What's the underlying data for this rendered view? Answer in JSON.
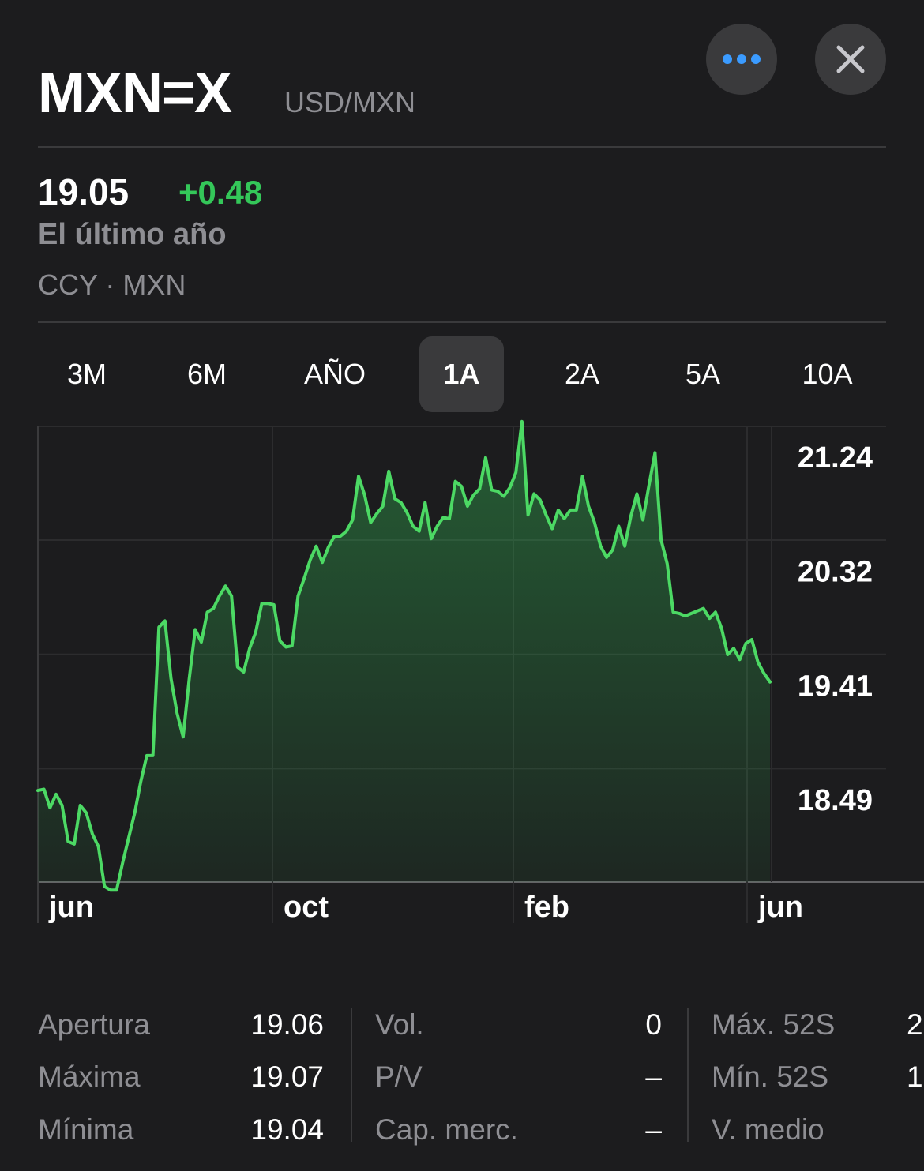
{
  "header": {
    "symbol": "MXN=X",
    "pair": "USD/MXN"
  },
  "quote": {
    "price": "19.05",
    "change": "+0.48",
    "period": "El último año",
    "exchange": "CCY · MXN"
  },
  "tabs": [
    {
      "label": "3M",
      "active": false
    },
    {
      "label": "6M",
      "active": false
    },
    {
      "label": "AÑO",
      "active": false
    },
    {
      "label": "1A",
      "active": true
    },
    {
      "label": "2A",
      "active": false
    },
    {
      "label": "5A",
      "active": false
    },
    {
      "label": "10A",
      "active": false
    }
  ],
  "colors": {
    "accent_green": "#34c759",
    "accent_blue": "#3b9bff",
    "background": "#1c1c1e"
  },
  "icons": {
    "more": "ellipsis-icon",
    "close": "close-icon"
  },
  "chart_data": {
    "type": "area",
    "y_ticks": [
      "21.24",
      "20.32",
      "19.41",
      "18.49"
    ],
    "x_ticks": [
      "jun",
      "oct",
      "feb",
      "jun"
    ],
    "ylim": [
      17.6,
      21.24
    ],
    "x": [
      0,
      1,
      2,
      3,
      4,
      5,
      6,
      7,
      8,
      9,
      10,
      11,
      12,
      13,
      14,
      15,
      16,
      17,
      18,
      19,
      20,
      21,
      22,
      23,
      24,
      25,
      26,
      27,
      28,
      29,
      30,
      31,
      32,
      33,
      34,
      35,
      36,
      37,
      38,
      39,
      40,
      41,
      42,
      43,
      44,
      45,
      46,
      47,
      48,
      49,
      50,
      51,
      52,
      53,
      54,
      55,
      56,
      57,
      58,
      59,
      60,
      61,
      62,
      63,
      64,
      65,
      66,
      67,
      68,
      69,
      70,
      71,
      72,
      73,
      74,
      75,
      76,
      77,
      78,
      79,
      80,
      81,
      82,
      83,
      84,
      85,
      86,
      87,
      88,
      89,
      90,
      91,
      92,
      93,
      94,
      95,
      96,
      97,
      98,
      99,
      100,
      101,
      102,
      103,
      104,
      105,
      106,
      107,
      108,
      109,
      110,
      111,
      112,
      113,
      114,
      115,
      116,
      117,
      118,
      119,
      120,
      121,
      122,
      123,
      124,
      125,
      126,
      127,
      128,
      129,
      130,
      131,
      132,
      133,
      134,
      135,
      136,
      137,
      138,
      139,
      140,
      141,
      142,
      143,
      144,
      145,
      146,
      147,
      148,
      149,
      150,
      151,
      152,
      153,
      154,
      155,
      156,
      157,
      158,
      159,
      160,
      161,
      162,
      163
    ],
    "values": [
      18.56,
      18.57,
      18.42,
      18.53,
      18.44,
      18.15,
      18.13,
      18.44,
      18.38,
      18.21,
      18.11,
      17.79,
      17.76,
      17.76,
      17.98,
      18.18,
      18.38,
      18.63,
      18.84,
      18.84,
      19.87,
      19.92,
      19.46,
      19.18,
      18.99,
      19.45,
      19.85,
      19.75,
      19.99,
      20.02,
      20.12,
      20.2,
      20.12,
      19.55,
      19.51,
      19.7,
      19.83,
      20.06,
      20.06,
      20.05,
      19.76,
      19.71,
      19.72,
      20.12,
      20.26,
      20.41,
      20.52,
      20.39,
      20.51,
      20.6,
      20.6,
      20.64,
      20.73,
      21.08,
      20.93,
      20.71,
      20.78,
      20.84,
      21.12,
      20.9,
      20.87,
      20.79,
      20.68,
      20.64,
      20.87,
      20.58,
      20.68,
      20.75,
      20.74,
      21.04,
      21.0,
      20.84,
      20.93,
      20.98,
      21.23,
      20.97,
      20.96,
      20.92,
      20.99,
      21.11,
      21.52,
      20.77,
      20.94,
      20.89,
      20.77,
      20.66,
      20.81,
      20.74,
      20.81,
      20.81,
      21.08,
      20.84,
      20.71,
      20.52,
      20.43,
      20.49,
      20.68,
      20.52,
      20.76,
      20.94,
      20.73,
      21.01,
      21.27,
      20.57,
      20.38,
      19.99,
      19.98,
      19.96,
      19.98,
      20.0,
      20.02,
      19.94,
      19.99,
      19.86,
      19.65,
      19.7,
      19.61,
      19.74,
      19.77,
      19.59,
      19.5,
      19.43
    ]
  },
  "stats": [
    [
      {
        "label": "Apertura",
        "value": "19.06"
      },
      {
        "label": "Máxima",
        "value": "19.07"
      },
      {
        "label": "Mínima",
        "value": "19.04"
      }
    ],
    [
      {
        "label": "Vol.",
        "value": "0"
      },
      {
        "label": "P/V",
        "value": "–"
      },
      {
        "label": "Cap. merc.",
        "value": "–"
      }
    ],
    [
      {
        "label": "Máx. 52S",
        "value": "2"
      },
      {
        "label": "Mín. 52S",
        "value": "1"
      },
      {
        "label": "V. medio",
        "value": ""
      }
    ]
  ]
}
